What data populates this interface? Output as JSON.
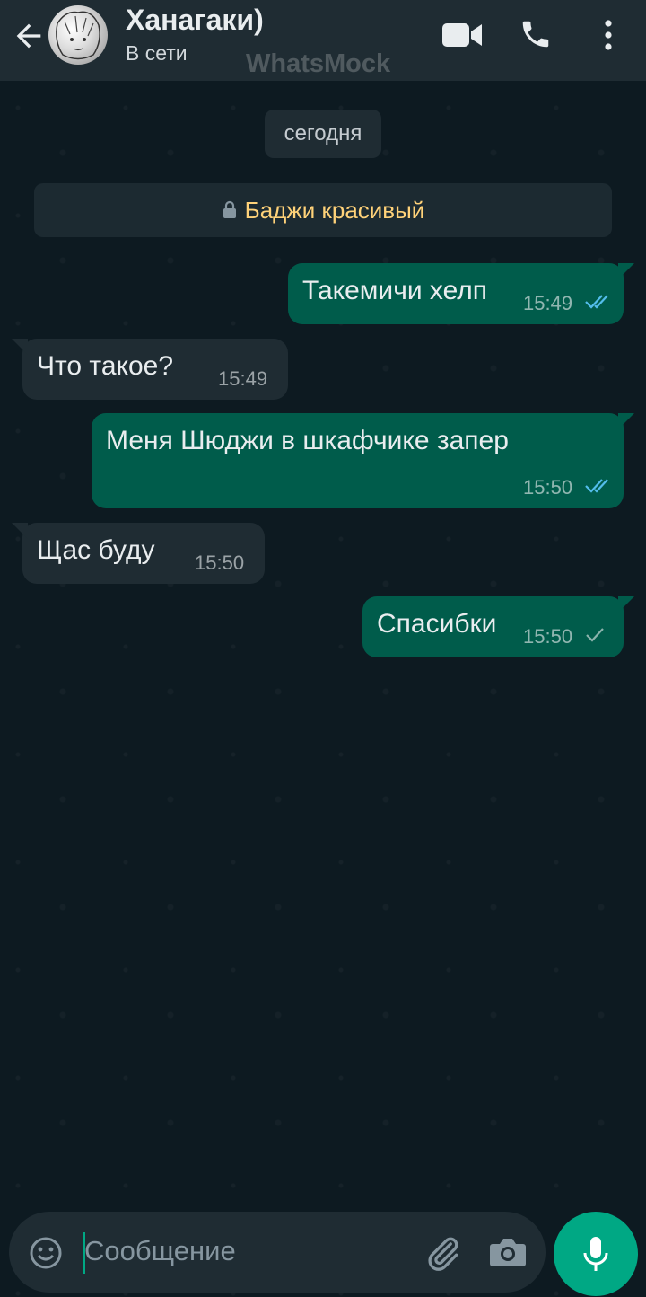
{
  "header": {
    "contact_name": "Ханагаки)",
    "status": "В сети",
    "watermark": "WhatsMock"
  },
  "chat": {
    "date_label": "сегодня",
    "encryption_banner": "Баджи красивый",
    "messages": [
      {
        "direction": "outgoing",
        "text": "Такемичи хелп",
        "time": "15:49",
        "ticks": "read"
      },
      {
        "direction": "incoming",
        "text": "Что такое?",
        "time": "15:49"
      },
      {
        "direction": "outgoing",
        "text": "Меня Шюджи в шкафчике запер",
        "time": "15:50",
        "ticks": "read"
      },
      {
        "direction": "incoming",
        "text": "Щас буду",
        "time": "15:50"
      },
      {
        "direction": "outgoing",
        "text": "Спасибки",
        "time": "15:50",
        "ticks": "sent"
      }
    ]
  },
  "composer": {
    "placeholder": "Сообщение"
  },
  "icons": {
    "back": "back-arrow-icon",
    "video": "video-call-icon",
    "call": "phone-call-icon",
    "menu": "more-vertical-icon",
    "lock": "lock-icon",
    "emoji": "emoji-icon",
    "attach": "paperclip-icon",
    "camera": "camera-icon",
    "mic": "microphone-icon"
  },
  "colors": {
    "header_bg": "#1f2c33",
    "outgoing_bubble": "#005c4b",
    "incoming_bubble": "#1f2c33",
    "accent": "#00a884",
    "read_ticks": "#53bdeb",
    "banner_text": "#ffd279"
  }
}
